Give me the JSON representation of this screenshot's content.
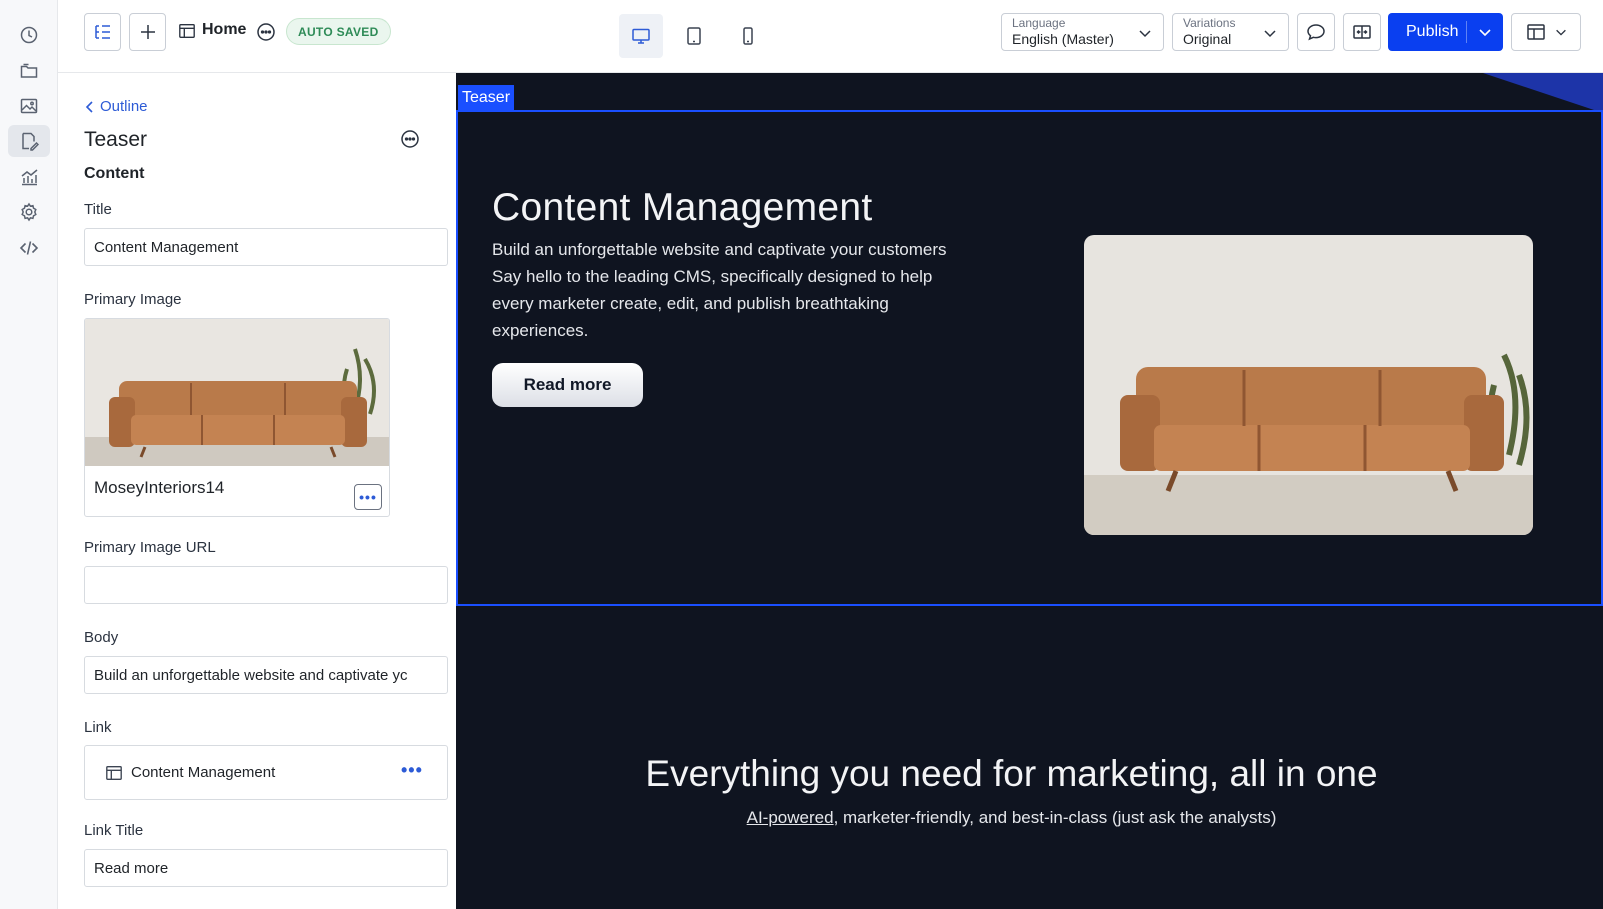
{
  "toolbar": {
    "page_name": "Home",
    "status_badge": "AUTO SAVED",
    "language": {
      "caption": "Language",
      "value": "English (Master)"
    },
    "variations": {
      "caption": "Variations",
      "value": "Original"
    },
    "publish_label": "Publish"
  },
  "panel": {
    "back_label": "Outline",
    "title": "Teaser",
    "section": "Content",
    "fields": {
      "title_label": "Title",
      "title_value": "Content Management",
      "image_label": "Primary Image",
      "image_name": "MoseyInteriors14",
      "image_url_label": "Primary Image URL",
      "image_url_value": "",
      "body_label": "Body",
      "body_value": "Build an unforgettable website and captivate yc",
      "link_label": "Link",
      "link_value": "Content Management",
      "link_title_label": "Link Title",
      "link_title_value": "Read more"
    }
  },
  "canvas": {
    "teaser_tag": "Teaser",
    "hero": {
      "title": "Content Management",
      "body": "Build an unforgettable website and captivate your customers Say hello to the leading CMS, specifically designed to help every marketer create, edit, and publish breathtaking experiences.",
      "button": "Read more"
    },
    "section2": {
      "title": "Everything you need for marketing, all in one",
      "sub_link": "AI-powered",
      "sub_rest": ", marketer-friendly, and best-in-class (just ask the analysts)"
    }
  },
  "colors": {
    "accent": "#0a3ff0",
    "canvas_bg": "#0f1420",
    "selection": "#1a4fff",
    "status_green": "#2e8b57"
  },
  "icons": {
    "rail": [
      "clock-icon",
      "folder-icon",
      "image-icon",
      "edit-page-icon",
      "analytics-icon",
      "settings-icon",
      "code-icon"
    ],
    "toolbar": [
      "outline-icon",
      "plus-icon",
      "page-icon",
      "more-icon",
      "desktop-icon",
      "tablet-icon",
      "mobile-icon",
      "comment-icon",
      "compare-icon",
      "layout-icon"
    ]
  }
}
